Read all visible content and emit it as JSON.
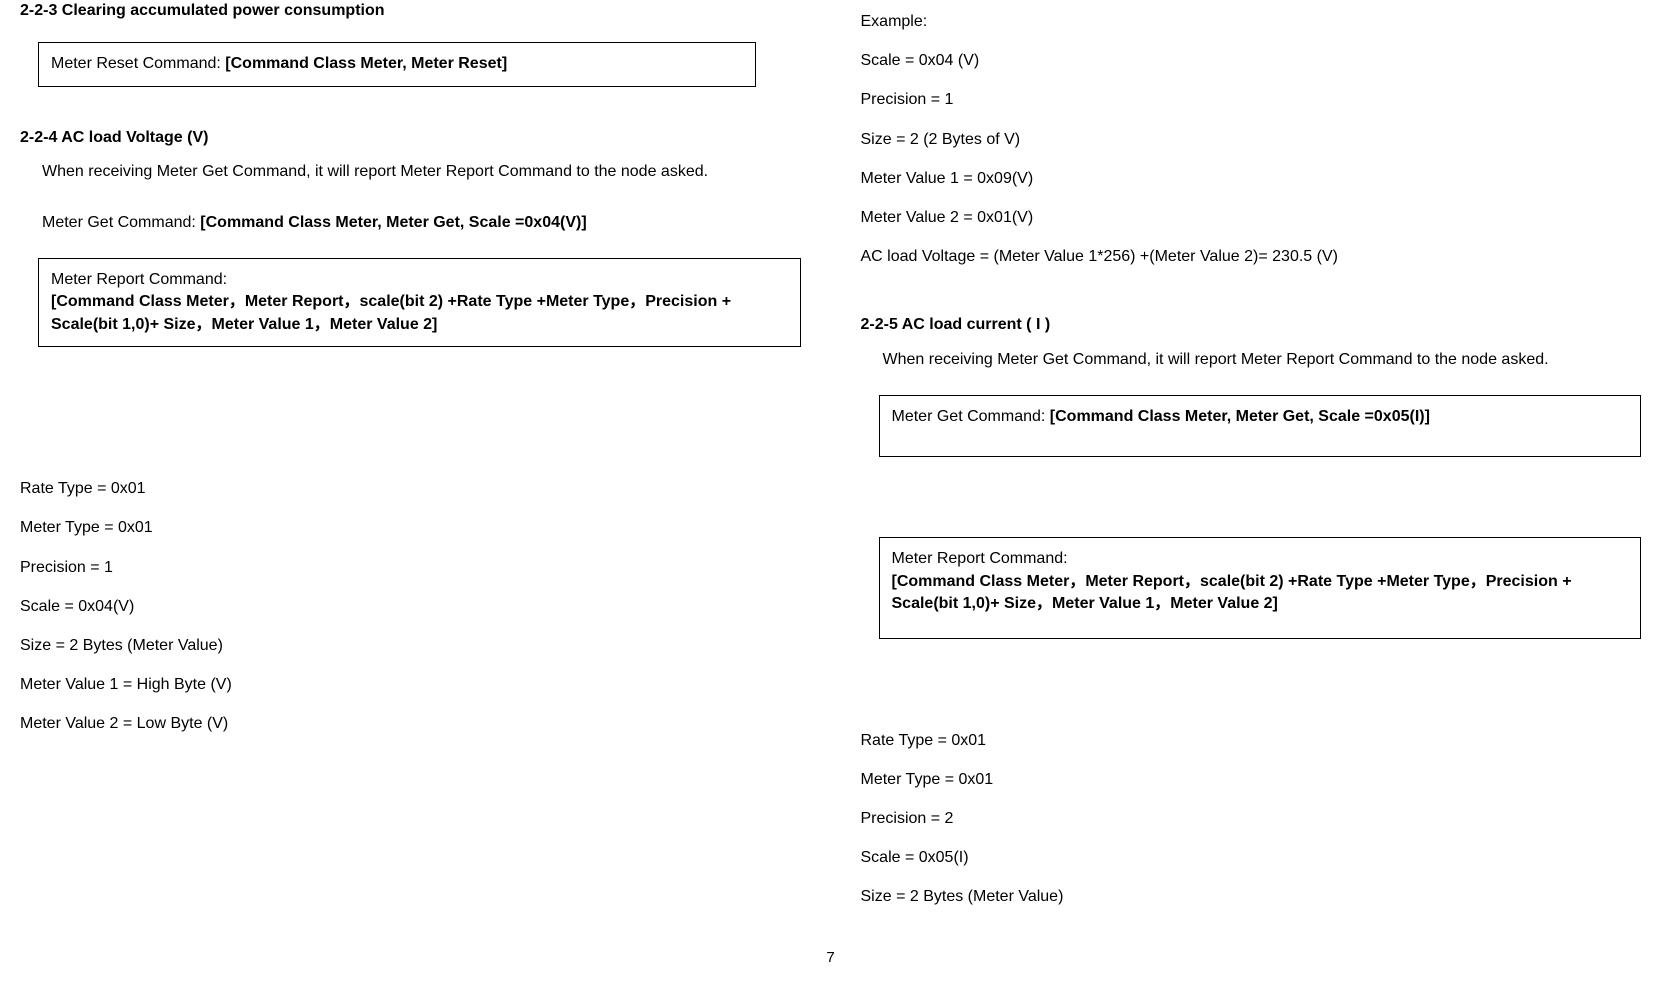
{
  "left": {
    "h223": "2-2-3 Clearing accumulated power consumption",
    "box1_label": "Meter Reset Command: ",
    "box1_content": "[Command Class Meter, Meter Reset]",
    "h224": "2-2-4 AC load Voltage (V)",
    "p224": "When receiving Meter Get Command, it will report Meter Report Command to the node asked.",
    "get224_label": "Meter Get Command: ",
    "get224_content": "[Command Class Meter, Meter Get, Scale =0x04(V)]",
    "box2_label": "Meter Report Command:",
    "box2_content": "[Command Class Meter，Meter Report，scale(bit 2) +Rate Type +Meter Type，Precision + Scale(bit 1,0)+ Size，Meter Value 1，Meter Value 2]",
    "params224": [
      "Rate Type = 0x01",
      "Meter Type = 0x01",
      "Precision = 1",
      "Scale = 0x04(V)",
      "Size = 2 Bytes (Meter Value)",
      "Meter Value 1 = High Byte (V)",
      "Meter Value 2 = Low Byte (V)"
    ]
  },
  "right": {
    "example_label": "Example:",
    "example_lines": [
      "Scale = 0x04 (V)",
      "Precision = 1",
      "Size = 2 (2 Bytes of  V)",
      "Meter Value 1 =  0x09(V)",
      "Meter Value 2 =  0x01(V)",
      "AC load Voltage =  (Meter Value 1*256) +(Meter Value 2)= 230.5 (V)"
    ],
    "h225": "2-2-5 AC load current ( I )",
    "p225": "When receiving Meter Get Command, it will report Meter Report Command to the node asked.",
    "box3_label": "Meter Get Command: ",
    "box3_content": "[Command Class Meter, Meter Get, Scale =0x05(I)]",
    "box4_label": "Meter Report Command:",
    "box4_content": "[Command Class Meter，Meter Report，scale(bit 2) +Rate Type +Meter Type，Precision + Scale(bit 1,0)+ Size，Meter Value 1，Meter Value 2]",
    "params225": [
      "Rate Type = 0x01",
      "Meter Type = 0x01",
      "Precision = 2",
      "Scale = 0x05(I)",
      "Size = 2 Bytes (Meter Value)"
    ]
  },
  "page_number": "7"
}
